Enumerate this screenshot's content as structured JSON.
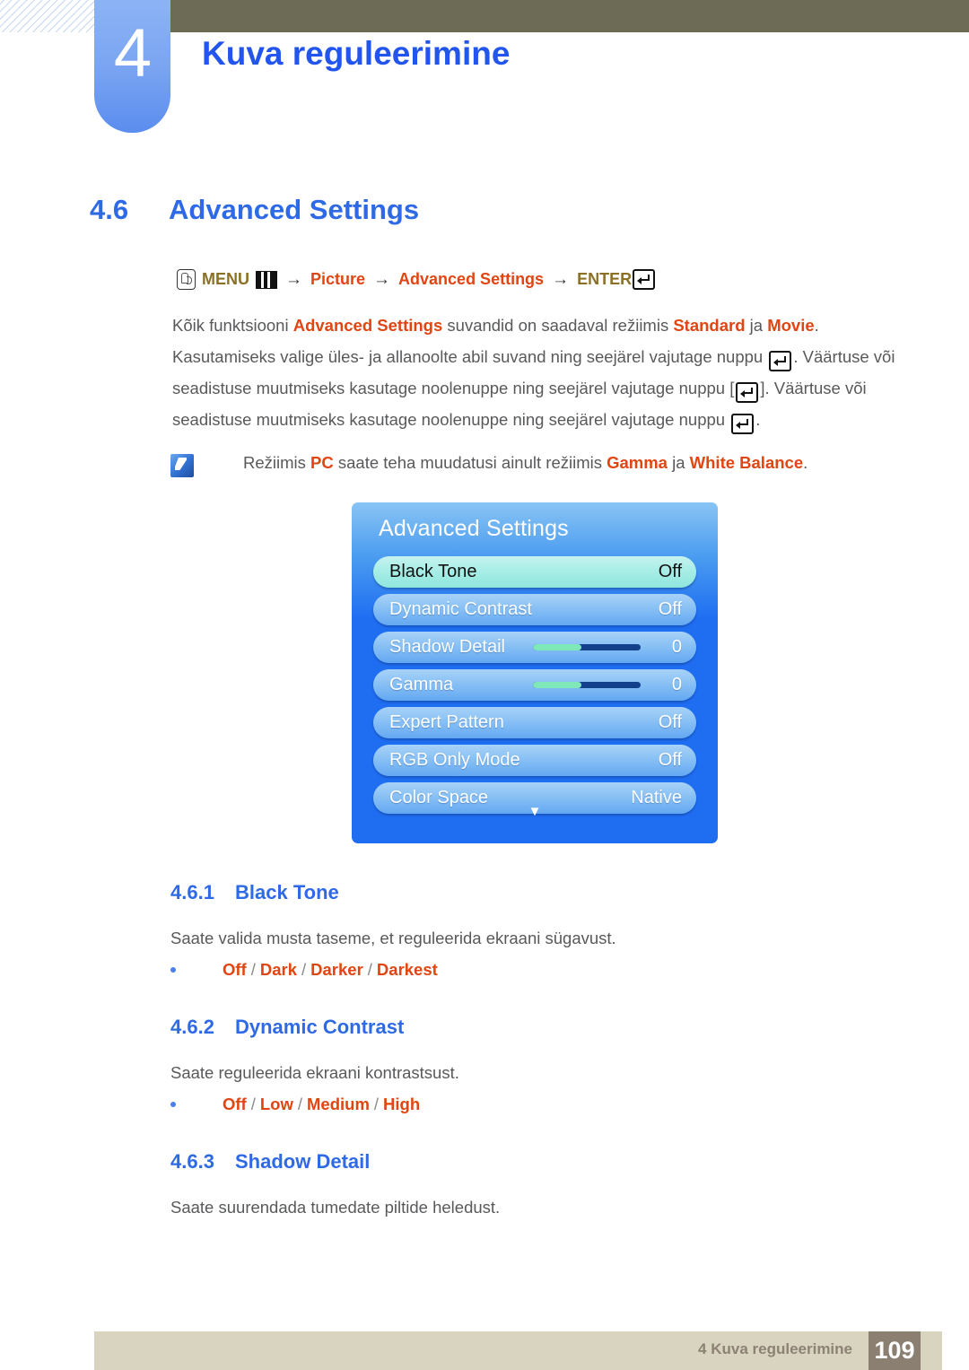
{
  "header": {
    "chapter_number": "4",
    "chapter_title": "Kuva reguleerimine"
  },
  "section": {
    "number": "4.6",
    "title": "Advanced Settings"
  },
  "menu_path": {
    "hand_icon": "hand-pointer-icon",
    "menu_label": "MENU",
    "menu_icon": "menu-bars-icon",
    "arrow1": "→",
    "step1": "Picture",
    "arrow2": "→",
    "step2": "Advanced Settings",
    "arrow3": "→",
    "enter_label": "ENTER",
    "enter_icon": "enter-key-icon"
  },
  "paragraph": {
    "t1": "Kõik funktsiooni ",
    "h1": "Advanced Settings",
    "t2": " suvandid on saadaval režiimis ",
    "h2": "Standard",
    "t3": " ja ",
    "h3": "Movie",
    "t4": ". Kasutamiseks valige üles- ja allanoolte abil suvand ning seejärel vajutage nuppu ",
    "t5": ". Väärtuse või seadistuse muutmiseks kasutage noolenuppe ning seejärel vajutage nuppu [",
    "t6": "]. Väärtuse või seadistuse muutmiseks kasutage noolenuppe ning seejärel vajutage nuppu ",
    "t7": "."
  },
  "note": {
    "icon": "samsung-note-icon",
    "t1": "Režiimis ",
    "h1": "PC",
    "t2": " saate teha muudatusi ainult režiimis ",
    "h2": "Gamma",
    "t3": " ja ",
    "h3": "White Balance",
    "t4": "."
  },
  "osd": {
    "title": "Advanced Settings",
    "chevron_icon": "chevron-down-icon",
    "rows": [
      {
        "label": "Black Tone",
        "value": "Off",
        "type": "value",
        "selected": true
      },
      {
        "label": "Dynamic Contrast",
        "value": "Off",
        "type": "value",
        "selected": false
      },
      {
        "label": "Shadow Detail",
        "value": "0",
        "type": "slider",
        "selected": false,
        "fill_pct": 45
      },
      {
        "label": "Gamma",
        "value": "0",
        "type": "slider",
        "selected": false,
        "fill_pct": 45
      },
      {
        "label": "Expert Pattern",
        "value": "Off",
        "type": "value",
        "selected": false
      },
      {
        "label": "RGB Only Mode",
        "value": "Off",
        "type": "value",
        "selected": false
      },
      {
        "label": "Color Space",
        "value": "Native",
        "type": "value",
        "selected": false
      }
    ]
  },
  "subsections": [
    {
      "number": "4.6.1",
      "title": "Black Tone",
      "description": "Saate valida musta taseme, et reguleerida ekraani sügavust.",
      "options": [
        "Off",
        "Dark",
        "Darker",
        "Darkest"
      ]
    },
    {
      "number": "4.6.2",
      "title": "Dynamic Contrast",
      "description": "Saate reguleerida ekraani kontrastsust.",
      "options": [
        "Off",
        "Low",
        "Medium",
        "High"
      ]
    },
    {
      "number": "4.6.3",
      "title": "Shadow Detail",
      "description": "Saate suurendada tumedate piltide heledust.",
      "options": []
    }
  ],
  "footer": {
    "text": "4 Kuva reguleerimine",
    "page": "109"
  },
  "colors": {
    "heading_blue": "#2f6ae6",
    "highlight_orange": "#e04512",
    "olive": "#6d6a55",
    "footer_bg": "#d9d4c0",
    "page_box": "#8a7f71",
    "osd_blue": "#1f6ef2",
    "osd_selected": "#a8eee7",
    "slider_fill": "#7fe8b8",
    "slider_track": "#12408a"
  }
}
